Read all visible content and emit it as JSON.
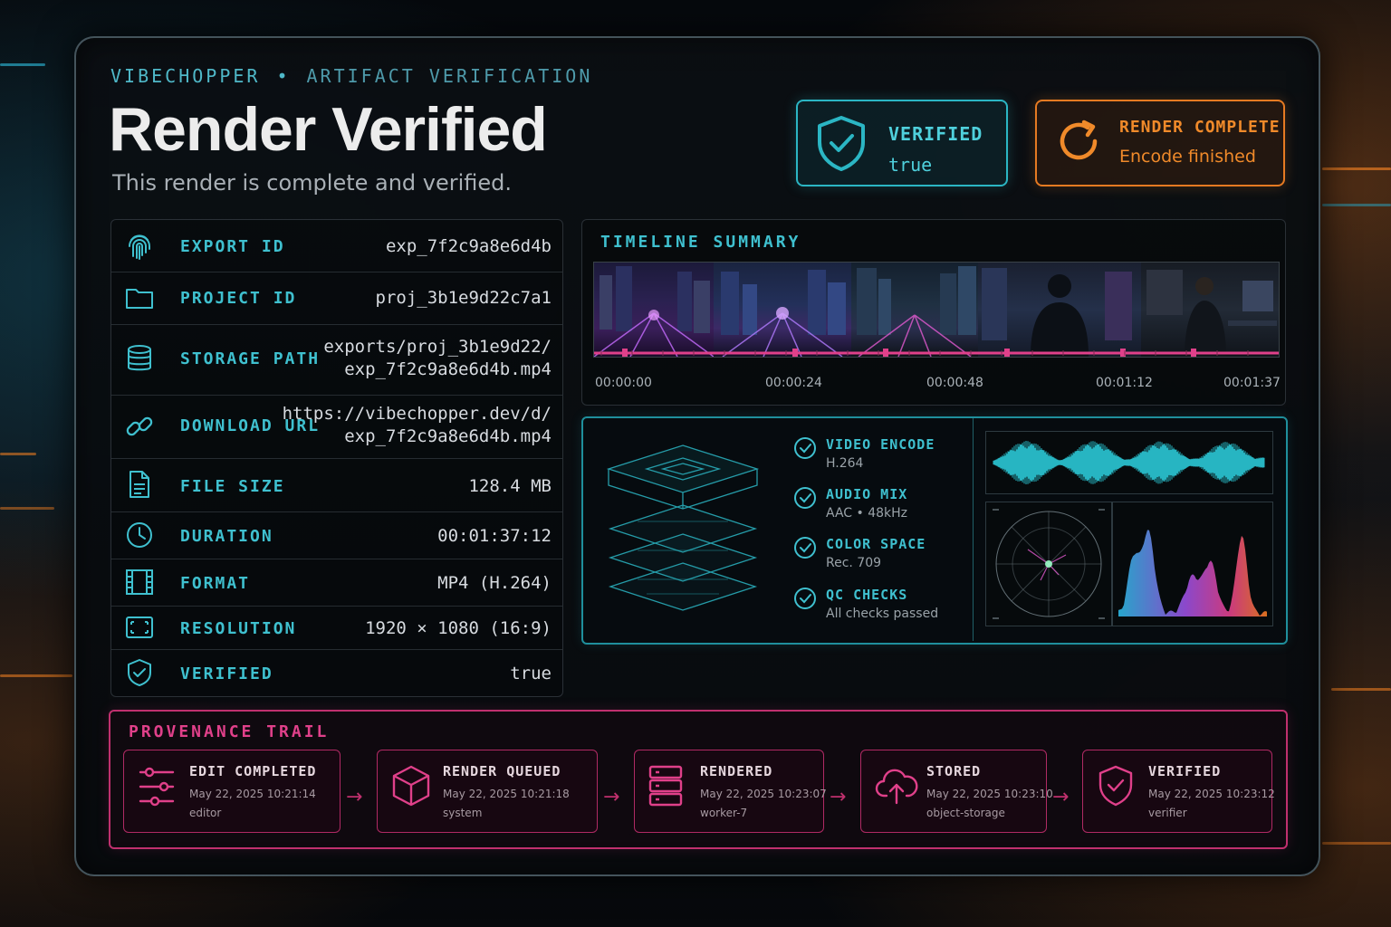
{
  "header": {
    "brand": "VIBECHOPPER",
    "separator": "•",
    "section": "ARTIFACT VERIFICATION",
    "title": "Render Verified",
    "subtitle": "This render is complete and verified."
  },
  "badges": {
    "verified": {
      "title": "VERIFIED",
      "value": "true",
      "color": "#2bb6c4",
      "icon": "shield-check-icon"
    },
    "render": {
      "title": "RENDER COMPLETE",
      "value": "Encode finished",
      "color": "#e57a22",
      "icon": "refresh-icon"
    }
  },
  "metadata": [
    {
      "label": "EXPORT ID",
      "value": "exp_7f2c9a8e6d4b",
      "icon": "fingerprint-icon"
    },
    {
      "label": "PROJECT ID",
      "value": "proj_3b1e9d22c7a1",
      "icon": "folder-icon"
    },
    {
      "label": "STORAGE PATH",
      "value_line1": "exports/proj_3b1e9d22/",
      "value_line2": "exp_7f2c9a8e6d4b.mp4",
      "icon": "database-icon"
    },
    {
      "label": "DOWNLOAD URL",
      "value_line1": "https://vibechopper.dev/d/",
      "value_line2": "exp_7f2c9a8e6d4b.mp4",
      "icon": "link-icon"
    },
    {
      "label": "FILE SIZE",
      "value": "128.4 MB",
      "icon": "file-icon"
    },
    {
      "label": "DURATION",
      "value": "00:01:37:12",
      "icon": "clock-icon"
    },
    {
      "label": "FORMAT",
      "value": "MP4 (H.264)",
      "icon": "film-icon"
    },
    {
      "label": "RESOLUTION",
      "value": "1920 × 1080 (16:9)",
      "icon": "frame-icon"
    },
    {
      "label": "VERIFIED",
      "value": "true",
      "icon": "shield-check-icon"
    }
  ],
  "timeline": {
    "title": "TIMELINE SUMMARY",
    "ticks": [
      "00:00:00",
      "00:00:24",
      "00:00:48",
      "00:01:12",
      "00:01:37"
    ],
    "accent": "#e0408a"
  },
  "checks": [
    {
      "title": "VIDEO ENCODE",
      "detail": "H.264"
    },
    {
      "title": "AUDIO MIX",
      "detail": "AAC • 48kHz"
    },
    {
      "title": "COLOR SPACE",
      "detail": "Rec. 709"
    },
    {
      "title": "QC CHECKS",
      "detail": "All checks passed"
    }
  ],
  "provenance": {
    "title": "PROVENANCE TRAIL",
    "steps": [
      {
        "title": "EDIT COMPLETED",
        "date": "May 22, 2025 10:21:14",
        "actor": "editor",
        "icon": "sliders-icon"
      },
      {
        "title": "RENDER QUEUED",
        "date": "May 22, 2025 10:21:18",
        "actor": "system",
        "icon": "cube-icon"
      },
      {
        "title": "RENDERED",
        "date": "May 22, 2025 10:23:07",
        "actor": "worker-7",
        "icon": "server-icon"
      },
      {
        "title": "STORED",
        "date": "May 22, 2025 10:23:10",
        "actor": "object-storage",
        "icon": "cloud-upload-icon"
      },
      {
        "title": "VERIFIED",
        "date": "May 22, 2025 10:23:12",
        "actor": "verifier",
        "icon": "shield-check-icon"
      }
    ],
    "arrow": "→"
  }
}
